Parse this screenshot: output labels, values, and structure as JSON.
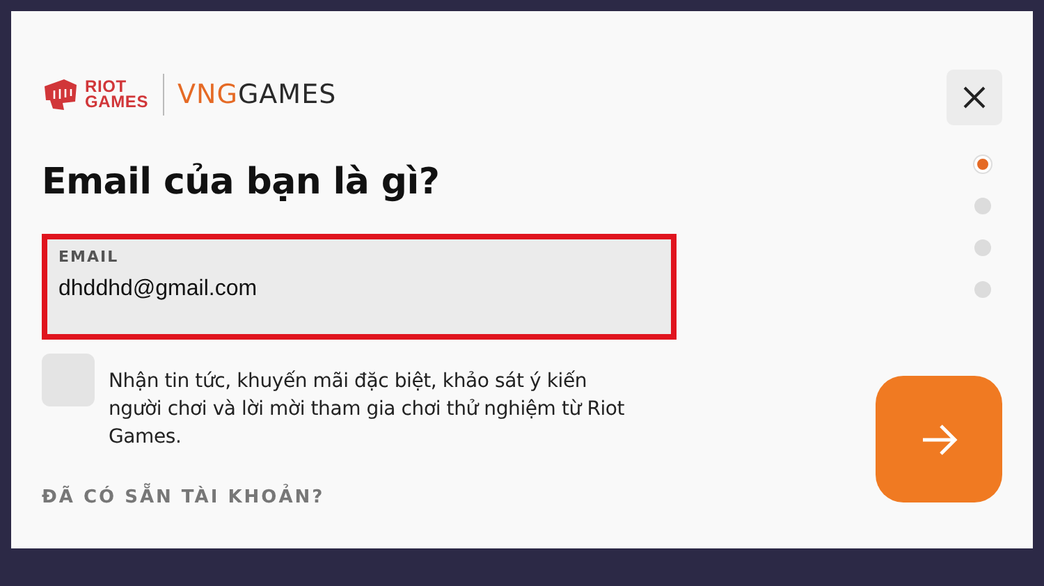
{
  "header": {
    "riot_logo": {
      "line_1": "RIOT",
      "line_2": "GAMES"
    },
    "partner_logo": {
      "prefix": "VNG",
      "suffix": "GAMES"
    }
  },
  "title": "Email của bạn là gì?",
  "email_field": {
    "label": "EMAIL",
    "value": "dhddhd@gmail.com",
    "highlighted": true
  },
  "consent": {
    "checked": false,
    "label": "Nhận tin tức, khuyến mãi đặc biệt, khảo sát ý kiến người chơi và lời mời tham gia chơi thử nghiệm từ Riot Games."
  },
  "account_link": "ĐÃ CÓ SẴN TÀI KHOẢN?",
  "progress_steps": [
    {
      "selected": true
    },
    {
      "selected": false
    },
    {
      "selected": false
    },
    {
      "selected": false
    }
  ]
}
